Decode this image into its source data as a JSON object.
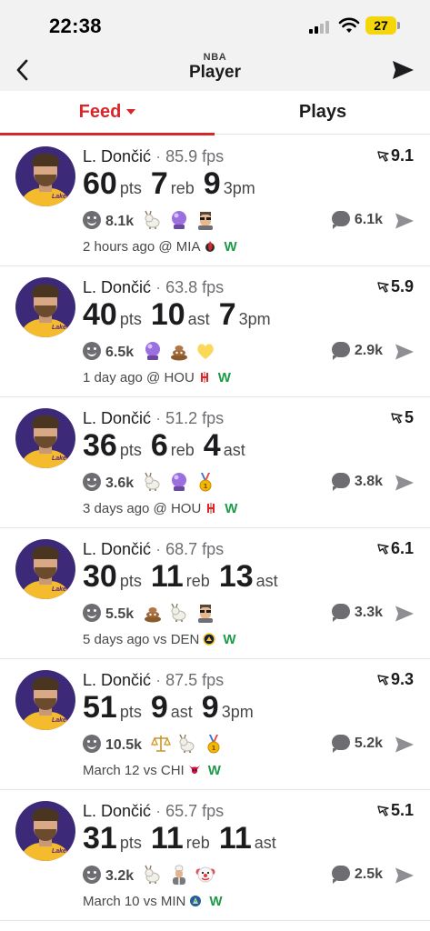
{
  "status_bar": {
    "time": "22:38",
    "battery": "27"
  },
  "nav": {
    "eyebrow": "NBA",
    "title": "Player"
  },
  "tabs": [
    {
      "label": "Feed",
      "active": true
    },
    {
      "label": "Plays",
      "active": false
    }
  ],
  "colors": {
    "accent": "#d9262b",
    "win": "#1e9b47",
    "battery": "#f5d60a",
    "avatar_bg": "#3c2a78",
    "jersey": "#f4bb2c"
  },
  "feed": [
    {
      "player": "L. Dončić",
      "fps": "85.9 fps",
      "rating": "9.1",
      "stats": [
        {
          "value": "60",
          "unit": "pts"
        },
        {
          "value": "7",
          "unit": "reb"
        },
        {
          "value": "9",
          "unit": "3pm"
        }
      ],
      "reactions": "8.1k",
      "emojis": [
        "goat-emoji",
        "crystal-ball-emoji",
        "sunglasses-man-emoji"
      ],
      "comments": "6.1k",
      "time": "2 hours ago @ MIA",
      "team_icon": "heat-logo-icon",
      "result": "W"
    },
    {
      "player": "L. Dončić",
      "fps": "63.8 fps",
      "rating": "5.9",
      "stats": [
        {
          "value": "40",
          "unit": "pts"
        },
        {
          "value": "10",
          "unit": "ast"
        },
        {
          "value": "7",
          "unit": "3pm"
        }
      ],
      "reactions": "6.5k",
      "emojis": [
        "crystal-ball-emoji",
        "poop-emoji",
        "yellow-heart-emoji"
      ],
      "comments": "2.9k",
      "time": "1 day ago @ HOU",
      "team_icon": "rockets-logo-icon",
      "result": "W"
    },
    {
      "player": "L. Dončić",
      "fps": "51.2 fps",
      "rating": "5",
      "stats": [
        {
          "value": "36",
          "unit": "pts"
        },
        {
          "value": "6",
          "unit": "reb"
        },
        {
          "value": "4",
          "unit": "ast"
        }
      ],
      "reactions": "3.6k",
      "emojis": [
        "goat-emoji",
        "crystal-ball-emoji",
        "gold-medal-emoji"
      ],
      "comments": "3.8k",
      "time": "3 days ago @ HOU",
      "team_icon": "rockets-logo-icon",
      "result": "W"
    },
    {
      "player": "L. Dončić",
      "fps": "68.7 fps",
      "rating": "6.1",
      "stats": [
        {
          "value": "30",
          "unit": "pts"
        },
        {
          "value": "11",
          "unit": "reb"
        },
        {
          "value": "13",
          "unit": "ast"
        }
      ],
      "reactions": "5.5k",
      "emojis": [
        "poop-emoji",
        "goat-emoji",
        "sunglasses-man-emoji"
      ],
      "comments": "3.3k",
      "time": "5 days ago vs DEN",
      "team_icon": "nuggets-logo-icon",
      "result": "W"
    },
    {
      "player": "L. Dončić",
      "fps": "87.5 fps",
      "rating": "9.3",
      "stats": [
        {
          "value": "51",
          "unit": "pts"
        },
        {
          "value": "9",
          "unit": "ast"
        },
        {
          "value": "9",
          "unit": "3pm"
        }
      ],
      "reactions": "10.5k",
      "emojis": [
        "scales-emoji",
        "goat-emoji",
        "gold-medal-emoji"
      ],
      "comments": "5.2k",
      "time": "March 12 vs CHI",
      "team_icon": "bulls-logo-icon",
      "result": "W"
    },
    {
      "player": "L. Dončić",
      "fps": "65.7 fps",
      "rating": "5.1",
      "stats": [
        {
          "value": "31",
          "unit": "pts"
        },
        {
          "value": "11",
          "unit": "reb"
        },
        {
          "value": "11",
          "unit": "ast"
        }
      ],
      "reactions": "3.2k",
      "emojis": [
        "goat-emoji",
        "chef-emoji",
        "clown-emoji"
      ],
      "comments": "2.5k",
      "time": "March 10 vs MIN",
      "team_icon": "timberwolves-logo-icon",
      "result": "W"
    }
  ]
}
